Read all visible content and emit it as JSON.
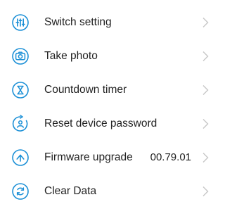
{
  "colors": {
    "accent": "#1a8fd6",
    "text": "#222222",
    "chevron": "#c6c6c6"
  },
  "settings": {
    "items": [
      {
        "label": "Switch setting",
        "icon": "switch-icon",
        "value": ""
      },
      {
        "label": "Take photo",
        "icon": "camera-icon",
        "value": ""
      },
      {
        "label": "Countdown timer",
        "icon": "timer-icon",
        "value": ""
      },
      {
        "label": "Reset device password",
        "icon": "reset-password-icon",
        "value": ""
      },
      {
        "label": "Firmware upgrade",
        "icon": "upgrade-icon",
        "value": "00.79.01"
      },
      {
        "label": "Clear Data",
        "icon": "clear-data-icon",
        "value": ""
      }
    ]
  }
}
